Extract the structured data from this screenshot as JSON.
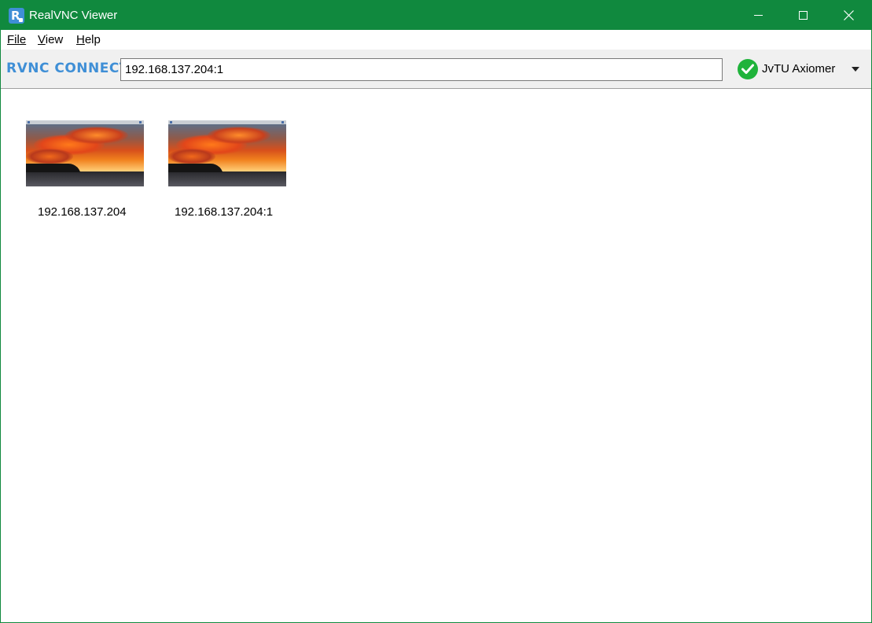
{
  "window": {
    "title": "RealVNC Viewer",
    "accent_color": "#10893e"
  },
  "menu": {
    "items": [
      {
        "label": "File"
      },
      {
        "label": "View"
      },
      {
        "label": "Help"
      }
    ]
  },
  "toolbar": {
    "logo_text": "RVNC CONNECT",
    "address_value": "192.168.137.204:1",
    "user_name": "JvTU Axiomer",
    "status_icon": "check-circle-icon",
    "status_color": "#1fb33b"
  },
  "connections": [
    {
      "label": "192.168.137.204",
      "thumbnail": "sunset-desktop-thumbnail"
    },
    {
      "label": "192.168.137.204:1",
      "thumbnail": "sunset-desktop-thumbnail"
    }
  ]
}
